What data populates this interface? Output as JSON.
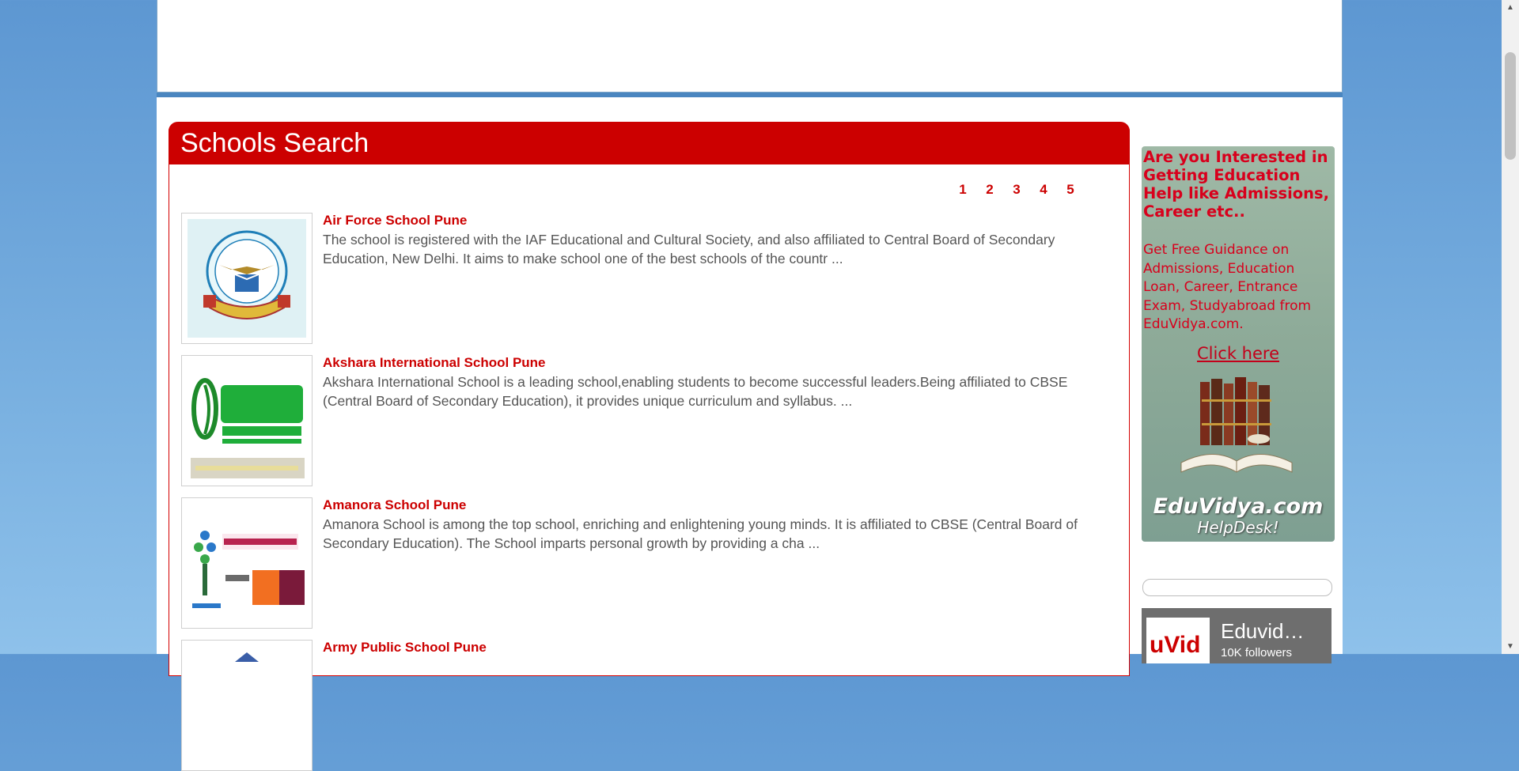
{
  "search": {
    "title": "Schools Search",
    "pages": [
      "1",
      "2",
      "3",
      "4",
      "5"
    ]
  },
  "schools": [
    {
      "name": "Air Force School Pune",
      "description": "The school is registered with the IAF Educational and Cultural Society, and also affiliated to Central Board of Secondary Education, New Delhi. It aims to make school one of the best schools of the countr ..."
    },
    {
      "name": "Akshara International School Pune",
      "description": "Akshara International School is a leading school,enabling students to become successful leaders.Being affiliated to CBSE (Central Board of Secondary Education), it provides unique curriculum and syllabus. ..."
    },
    {
      "name": "Amanora School Pune",
      "description": "Amanora School is among the top school, enriching and enlightening young minds. It is affiliated to CBSE (Central Board of Secondary Education). The School  imparts personal growth by providing a cha ..."
    },
    {
      "name": "Army Public School Pune",
      "description": ""
    }
  ],
  "ad": {
    "heading": "Are you Interested in Getting Education Help like Admissions, Career etc..",
    "text": "Get Free Guidance on Admissions, Education Loan, Career, Entrance Exam, Studyabroad from EduVidya.com.",
    "link": "Click here",
    "brand": "EduVidya.com",
    "brand_sub": "HelpDesk!"
  },
  "facebook": {
    "name": "Eduvid…",
    "followers": "10K followers",
    "thumb_text": "uVid"
  },
  "colors": {
    "accent": "#cc0000",
    "header_band": "#4a86c0"
  }
}
